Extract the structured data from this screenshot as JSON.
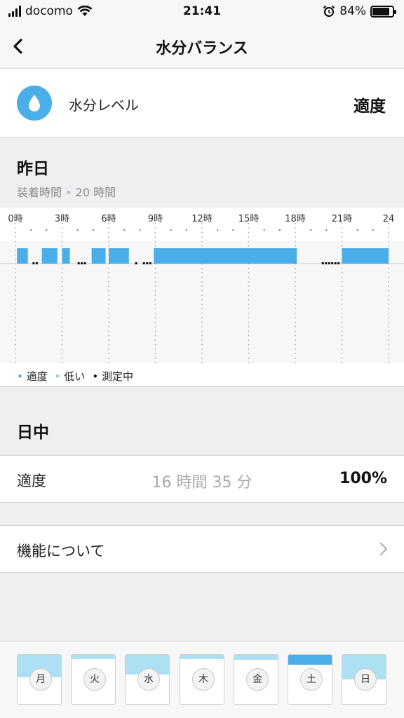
{
  "status": {
    "carrier": "docomo",
    "time": "21:41",
    "battery": "84%"
  },
  "nav": {
    "title": "水分バランス"
  },
  "level": {
    "label": "水分レベル",
    "value": "適度"
  },
  "yesterday": {
    "heading": "昨日",
    "wear_label": "装着時間",
    "wear_value": "20 時間"
  },
  "chart_data": {
    "type": "bar",
    "x_ticks": [
      "0時",
      "3時",
      "6時",
      "9時",
      "12時",
      "15時",
      "18時",
      "21時",
      "24"
    ],
    "xlim": [
      0,
      24
    ],
    "segments": [
      {
        "start": 0.1,
        "end": 0.8,
        "status": "適度"
      },
      {
        "start": 1.7,
        "end": 2.7,
        "status": "適度"
      },
      {
        "start": 3.0,
        "end": 3.5,
        "status": "適度"
      },
      {
        "start": 4.9,
        "end": 5.8,
        "status": "適度"
      },
      {
        "start": 6.0,
        "end": 7.3,
        "status": "適度"
      },
      {
        "start": 8.9,
        "end": 18.1,
        "status": "適度"
      },
      {
        "start": 21.0,
        "end": 24.0,
        "status": "適度"
      }
    ],
    "measuring": [
      {
        "start": 1.1,
        "end": 1.5
      },
      {
        "start": 4.0,
        "end": 4.7
      },
      {
        "start": 7.7,
        "end": 7.9
      },
      {
        "start": 8.2,
        "end": 8.8
      },
      {
        "start": 19.7,
        "end": 21.0
      }
    ],
    "legend": [
      "適度",
      "低い",
      "測定中"
    ],
    "colors": {
      "適度": "#4aaee8",
      "低い": "#8cc9ee",
      "測定中": "#111111"
    }
  },
  "daytime": {
    "heading": "日中",
    "label": "適度",
    "duration": "16 時間 35 分",
    "percent": "100%"
  },
  "about": {
    "label": "機能について"
  },
  "week": [
    {
      "day": "月",
      "level": 0.45,
      "selected": false
    },
    {
      "day": "火",
      "level": 0.08,
      "selected": false
    },
    {
      "day": "水",
      "level": 0.4,
      "selected": false
    },
    {
      "day": "木",
      "level": 0.08,
      "selected": false
    },
    {
      "day": "金",
      "level": 0.1,
      "selected": false
    },
    {
      "day": "土",
      "level": 0.2,
      "selected": true
    },
    {
      "day": "日",
      "level": 0.5,
      "selected": false
    }
  ]
}
